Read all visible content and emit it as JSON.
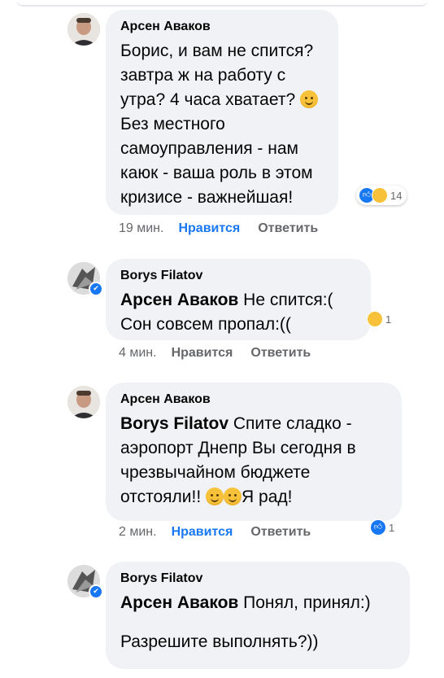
{
  "comments": [
    {
      "author": "Арсен Аваков",
      "mention": "",
      "lines": [
        "Борис, и вам не спится?",
        "завтра ж на работу с",
        "утра? 4 часа хватает?",
        "Без местного",
        "самоуправления - нам",
        "каюк - ваша роль в этом",
        "кризисе - важнейшая!"
      ],
      "reaction_count": "14",
      "time": "19 мин.",
      "like_label": "Нравится",
      "reply_label": "Ответить"
    },
    {
      "author": "Borys Filatov",
      "mention": "Арсен Аваков",
      "lines": [
        " Не спится:(",
        "Сон совсем пропал:(("
      ],
      "reaction_count": "1",
      "time": "4 мин.",
      "like_label": "Нравится",
      "reply_label": "Ответить"
    },
    {
      "author": "Арсен Аваков",
      "mention": "Borys Filatov",
      "lines": [
        " Спите сладко -",
        "аэропорт Днепр Вы сегодня в",
        "чрезвычайном бюджете",
        "отстояли!!",
        "Я рад!"
      ],
      "reaction_count": "1",
      "time": "2 мин.",
      "like_label": "Нравится",
      "reply_label": "Ответить"
    },
    {
      "author": "Borys Filatov",
      "mention": "Арсен Аваков",
      "lines": [
        " Понял, принял:)",
        "Разрешите выполнять?))"
      ],
      "reaction_count": "",
      "time": "",
      "like_label": "",
      "reply_label": ""
    }
  ],
  "colors": {
    "bubble": "#f0f2f5",
    "link_blue": "#1877f2",
    "meta_gray": "#65676b"
  }
}
